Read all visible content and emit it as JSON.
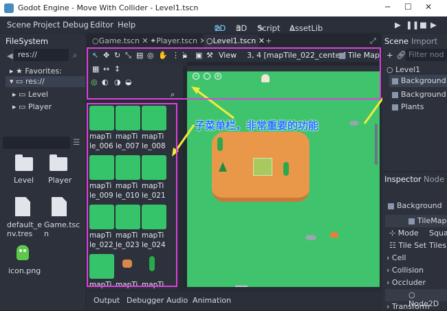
{
  "window": {
    "title": "Godot Engine - Move With Collider - Level1.tscn"
  },
  "menu": [
    "Scene",
    "Project",
    "Debug",
    "Editor",
    "Help"
  ],
  "workspaces": [
    "2D",
    "3D",
    "Script",
    "AssetLib"
  ],
  "filesystem": {
    "title": "FileSystem",
    "path": "res://",
    "favorites_label": "Favorites:",
    "tree": [
      "res://",
      "Level",
      "Player"
    ],
    "items": [
      {
        "label": "Level",
        "kind": "folder"
      },
      {
        "label": "Player",
        "kind": "folder"
      },
      {
        "label": "default_e nv.tres",
        "kind": "file"
      },
      {
        "label": "Game.tsc n",
        "kind": "file"
      },
      {
        "label": "icon.png",
        "kind": "image"
      }
    ]
  },
  "editor_tabs": [
    "Game.tscn",
    "Player.tscn",
    "Level1.tscn"
  ],
  "toolbar": {
    "view_label": "View",
    "coords": "3, 4 [mapTile_022_center]",
    "tilemap_label": "Tile Map"
  },
  "tiles": [
    "mapTi le_006",
    "mapTi le_007",
    "mapTi le_008",
    "mapTi le_009",
    "mapTi le_010",
    "mapTi le_021",
    "mapTi le_022_",
    "mapTi le_023",
    "mapTi le_024",
    "mapTi",
    "mapTi",
    "mapTi"
  ],
  "scene": {
    "tabs": [
      "Scene",
      "Import"
    ],
    "filter_placeholder": "Filter nod",
    "nodes": [
      "Level1",
      "Background",
      "Background",
      "Plants"
    ]
  },
  "inspector": {
    "tabs": [
      "Inspector",
      "Node"
    ],
    "object": "Background",
    "class": "TileMap",
    "rows": [
      {
        "label": "Mode",
        "value": "Squa"
      },
      {
        "label": "Tile Set",
        "value": "Tiles"
      }
    ],
    "sections": [
      "Cell",
      "Collision",
      "Occluder"
    ],
    "base": "Node2D",
    "last": "Transform"
  },
  "bottom_tabs": [
    "Output",
    "Debugger",
    "Audio",
    "Animation"
  ],
  "annotation": "子菜单栏，非常重要的功能",
  "colors": {
    "accent": "#7fd0ff",
    "magenta": "#e040e0",
    "grass": "#3fc46d",
    "sand": "#e9984a"
  }
}
